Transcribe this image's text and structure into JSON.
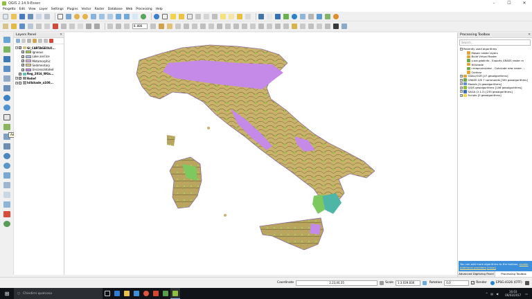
{
  "window": {
    "title": "QGIS 2.14.9-Essen",
    "minimize": "–",
    "maximize": "☐",
    "close": "✕"
  },
  "menu": [
    "Progetto",
    "Edit",
    "View",
    "Layer",
    "Settings",
    "Plugins",
    "Vector",
    "Raster",
    "Database",
    "Web",
    "Processing",
    "Help"
  ],
  "toolbar": {
    "scale_input": "0.000"
  },
  "left_toolbar": {
    "tooltip": "Add WFS Layer"
  },
  "layers_panel": {
    "title": "Layers Panel",
    "group": "GI_CARTAGEOLO...",
    "legend": [
      {
        "label": "Igneous",
        "color": "#a8d44b"
      },
      {
        "label": "Lake and Ice",
        "color": "#aec7e8"
      },
      {
        "label": "Metamorphic",
        "color": "#e8b3e8"
      },
      {
        "label": "Sedimentary",
        "color": "#e6d39a"
      },
      {
        "label": "Unconsolidated",
        "color": "#c58ae8"
      }
    ],
    "layers": [
      {
        "label": "Reg_2016_WGs...",
        "bold": true
      },
      {
        "label": "Relief",
        "bold": true
      },
      {
        "label": "hillshade_a100...",
        "bold": true
      }
    ]
  },
  "processing": {
    "title": "Processing Toolbox",
    "search_placeholder": "Search...",
    "recent_label": "Recently used algorithms",
    "recent": [
      "Mosaic raster layers",
      "Build Virtual Raster",
      "v.out.gdalinfo - Exports GRASS raster m",
      "Hillshade",
      "r.mapcalculator - Calculate new raster ...",
      "Contour"
    ],
    "providers": [
      "GDAL/OGR [47 geoalgorithms]",
      "GRASS GIS 7 commands [305 geoalgorithms]",
      "Models [0 geoalgorithms]",
      "QGIS geoalgorithms [106 geoalgorithms]",
      "SAGA (2.1.2) [235 geoalgorithms]",
      "Scripts [0 geoalgorithms]"
    ],
    "banner_text": "You can add more algorithms to the toolbox,",
    "banner_link1": "enable",
    "banner_link2": "additional providers",
    "banner_link3": "[close]",
    "tabs": [
      "Advanced Digitizing Panel",
      "Processing Toolbox"
    ]
  },
  "statusbar": {
    "coordinate_label": "Coordinate",
    "coordinate_value": "2.23,40.35",
    "scale_label": "Scale",
    "scale_value": "1:3.039.836",
    "rotation_label": "Rotation",
    "rotation_value": "0,0",
    "render_label": "Render",
    "crs": "EPSG:4326 (OTF)"
  },
  "taskbar": {
    "search_placeholder": "Chiedimi qualcosa",
    "time": "16:03",
    "date": "06/03/2017"
  },
  "colors": {
    "unconsolidated": "#c58ae8",
    "sedimentary": "#c9b36c",
    "igneous": "#a8d44b",
    "banner": "#3c8fdb"
  }
}
